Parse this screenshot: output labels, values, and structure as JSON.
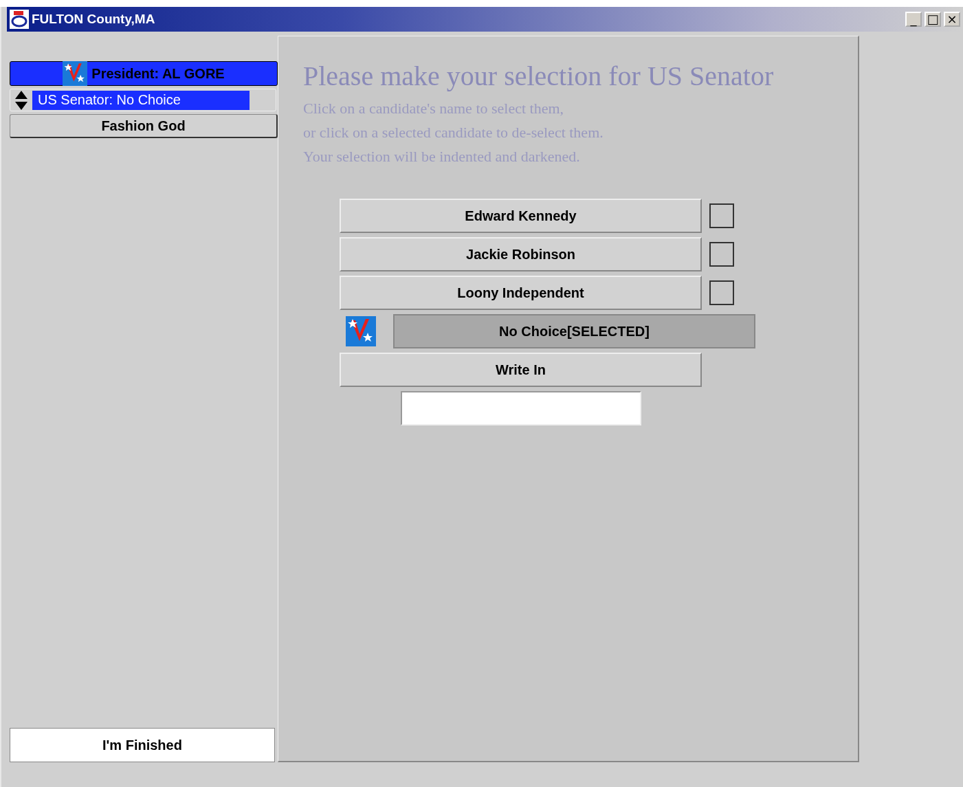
{
  "window": {
    "title": "FULTON County,MA",
    "controls": [
      "_",
      "□",
      "×"
    ]
  },
  "contests": [
    {
      "label": "President: AL GORE",
      "kind": "done"
    },
    {
      "label": "US Senator: No Choice",
      "kind": "current"
    },
    {
      "label": "Fashion God",
      "kind": "pending"
    }
  ],
  "finish_button": "I'm Finished",
  "heading": "Please make your selection for US Senator",
  "instructions": [
    "Click on a candidate's name to select them,",
    "or click on a selected candidate to de-select them.",
    "Your selection will be indented and darkened."
  ],
  "candidates": [
    {
      "name": "Edward Kennedy",
      "selected": false
    },
    {
      "name": "Jackie Robinson",
      "selected": false
    },
    {
      "name": "Loony Independent",
      "selected": false
    },
    {
      "name": "No Choice[SELECTED]",
      "selected": true
    }
  ],
  "write_in": {
    "label": "Write In"
  }
}
